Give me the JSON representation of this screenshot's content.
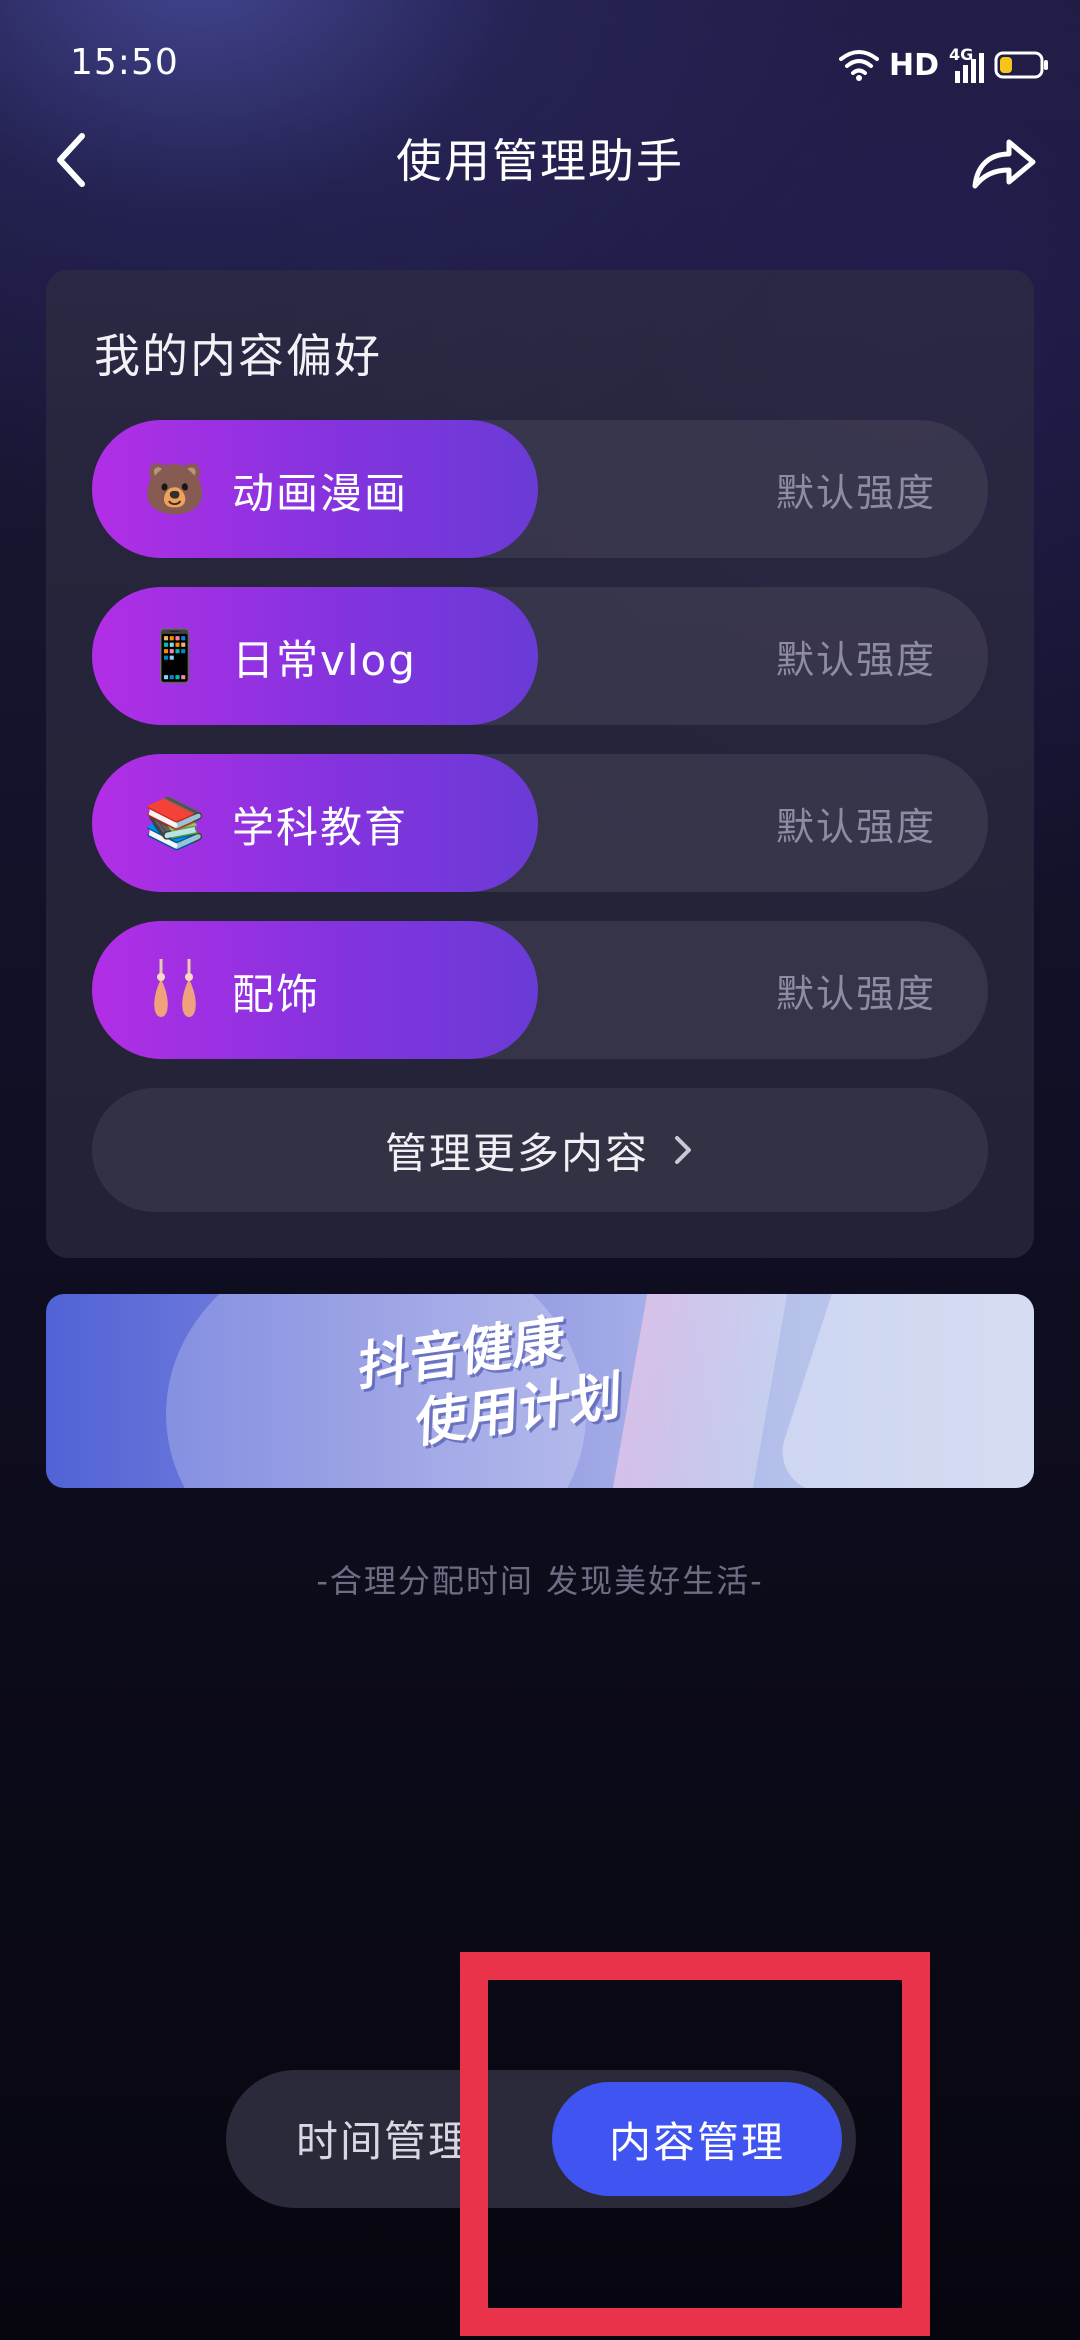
{
  "status_bar": {
    "time": "15:50",
    "network_label": "HD",
    "signal_label": "4G",
    "battery_color": "#f5c518"
  },
  "header": {
    "title": "使用管理助手",
    "back_icon": "chevron-left-icon",
    "share_icon": "share-icon"
  },
  "preferences": {
    "title": "我的内容偏好",
    "items": [
      {
        "label": "动画漫画",
        "emoji": "🐻",
        "icon": "bear-icon",
        "level": "默认强度"
      },
      {
        "label": "日常vlog",
        "emoji": "📱",
        "icon": "phone-icon",
        "level": "默认强度"
      },
      {
        "label": "学科教育",
        "emoji": "📚",
        "icon": "books-icon",
        "level": "默认强度"
      },
      {
        "label": "配饰",
        "emoji": "💧",
        "icon": "earrings-icon",
        "level": "默认强度"
      }
    ],
    "more_label": "管理更多内容"
  },
  "banner": {
    "line1": "抖音健康",
    "line2": "使用计划"
  },
  "tagline": "-合理分配时间 发现美好生活-",
  "switcher": {
    "time_tab": "时间管理",
    "content_tab": "内容管理",
    "active_color": "#3f54f0"
  },
  "highlight_color": "#e8334a"
}
